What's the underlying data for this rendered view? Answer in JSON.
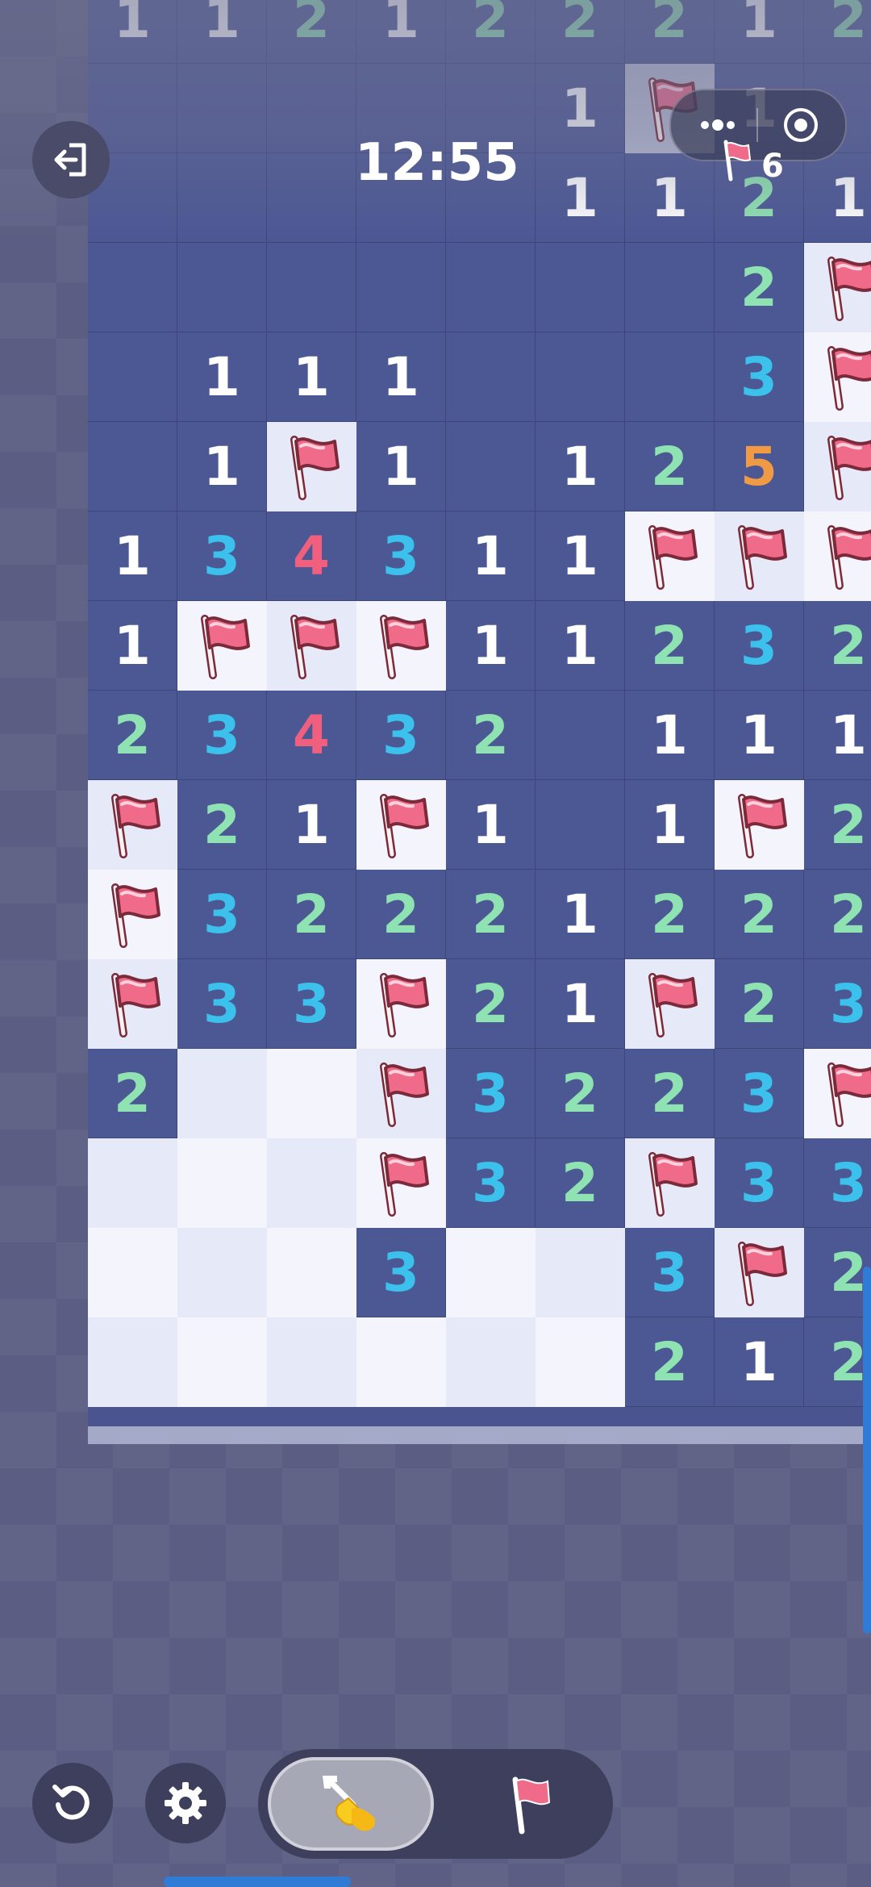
{
  "header": {
    "timer": "12:55",
    "flags_remaining": "6"
  },
  "board": {
    "rows": [
      [
        "1",
        "1",
        "2",
        "1",
        "2",
        "2",
        "2",
        "1",
        "2"
      ],
      [
        "D",
        "D",
        "D",
        "D",
        "D",
        "1",
        "S",
        "1",
        "D"
      ],
      [
        "D",
        "D",
        "D",
        "D",
        "D",
        "1",
        "1",
        "2",
        "1"
      ],
      [
        "D",
        "D",
        "D",
        "D",
        "D",
        "D",
        "D",
        "2",
        "F"
      ],
      [
        "D",
        "1",
        "1",
        "1",
        "D",
        "D",
        "D",
        "3",
        "F"
      ],
      [
        "D",
        "1",
        "F",
        "1",
        "D",
        "1",
        "2",
        "5",
        "F"
      ],
      [
        "1",
        "3",
        "4",
        "3",
        "1",
        "1",
        "F",
        "F",
        "F"
      ],
      [
        "1",
        "F",
        "F",
        "F",
        "1",
        "1",
        "2",
        "3",
        "2"
      ],
      [
        "2",
        "3",
        "4",
        "3",
        "2",
        "D",
        "1",
        "1",
        "1"
      ],
      [
        "F",
        "2",
        "1",
        "F",
        "1",
        "D",
        "1",
        "F",
        "2"
      ],
      [
        "F",
        "3",
        "2",
        "2",
        "2",
        "1",
        "2",
        "2",
        "2"
      ],
      [
        "F",
        "3",
        "3",
        "F",
        "2",
        "1",
        "F",
        "2",
        "3"
      ],
      [
        "2",
        "L",
        "L",
        "F",
        "3",
        "2",
        "2",
        "3",
        "F"
      ],
      [
        "L",
        "L",
        "L",
        "F",
        "3",
        "2",
        "F",
        "3",
        "3"
      ],
      [
        "L",
        "L",
        "L",
        "3",
        "L",
        "L",
        "3",
        "F",
        "2"
      ],
      [
        "L",
        "L",
        "L",
        "L",
        "L",
        "L",
        "2",
        "1",
        "2"
      ]
    ]
  },
  "controls": {
    "active_mode": "dig",
    "icons": {
      "exit": "exit-icon",
      "more": "more-dots-icon",
      "target": "target-icon",
      "undo": "undo-icon",
      "settings": "gear-icon",
      "dig": "shovel-icon",
      "flag": "flag-icon"
    }
  },
  "colors": {
    "num1": "#ffffff",
    "num2": "#8fe3b2",
    "num3": "#3cc0ec",
    "num4": "#f0607e",
    "num5": "#f19a45",
    "flag": "#f06a8a",
    "board_dark": "#4c5894",
    "board_light": "#e6e9f8"
  }
}
